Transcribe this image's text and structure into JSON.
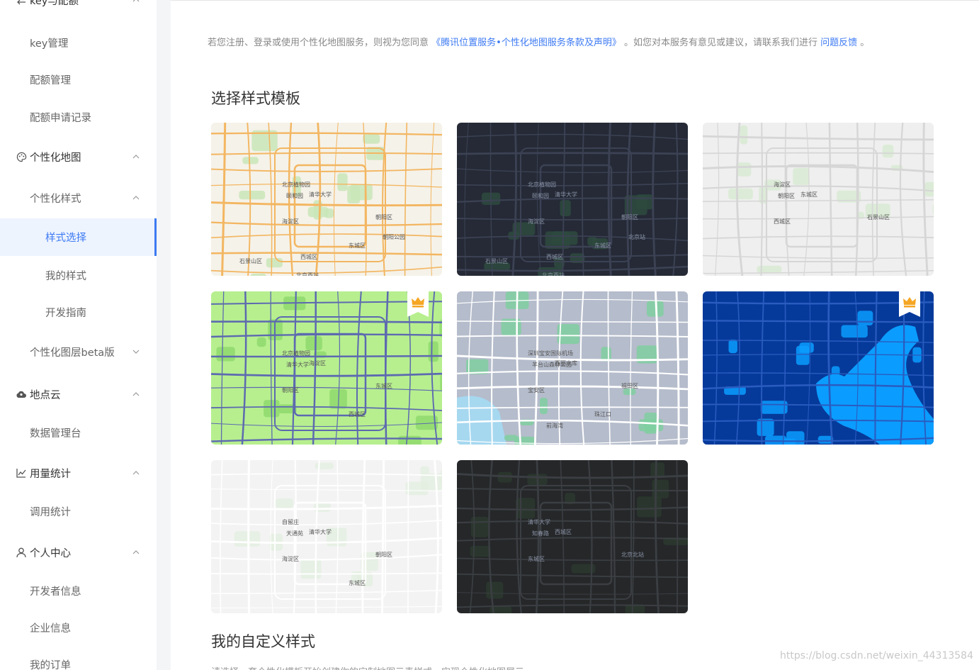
{
  "sidebar": {
    "items": [
      {
        "label": "key与配额",
        "level": "group",
        "icon": "swap-icon",
        "expanded": true
      },
      {
        "label": "key管理",
        "level": "sub"
      },
      {
        "label": "配额管理",
        "level": "sub"
      },
      {
        "label": "配额申请记录",
        "level": "sub"
      },
      {
        "label": "个性化地图",
        "level": "group",
        "icon": "palette-icon",
        "expanded": true
      },
      {
        "label": "个性化样式",
        "level": "sub",
        "expanded": true
      },
      {
        "label": "样式选择",
        "level": "sub2",
        "active": true
      },
      {
        "label": "我的样式",
        "level": "sub2"
      },
      {
        "label": "开发指南",
        "level": "sub2"
      },
      {
        "label": "个性化图层beta版",
        "level": "sub",
        "expanded": false
      },
      {
        "label": "地点云",
        "level": "group",
        "icon": "cloud-icon",
        "expanded": true
      },
      {
        "label": "数据管理台",
        "level": "sub"
      },
      {
        "label": "用量统计",
        "level": "group",
        "icon": "line-chart-icon",
        "expanded": true
      },
      {
        "label": "调用统计",
        "level": "sub"
      },
      {
        "label": "个人中心",
        "level": "group",
        "icon": "user-icon",
        "expanded": true
      },
      {
        "label": "开发者信息",
        "level": "sub"
      },
      {
        "label": "企业信息",
        "level": "sub"
      },
      {
        "label": "我的订单",
        "level": "sub"
      }
    ]
  },
  "notice": {
    "prefix": "若您注册、登录或使用个性化地图服务，则视为您同意",
    "terms_link": "《腾讯位置服务•个性化地图服务条款及声明》",
    "middle": "。如您对本服务有意见或建议，请联系我们进行",
    "feedback_link": "问题反馈",
    "suffix": "。"
  },
  "templates": {
    "title": "选择样式模板",
    "cards": [
      {
        "name": "classic-light",
        "bg": "#f5f2e9",
        "road": "#f3b661",
        "green": "#c9e6b8",
        "premium": false
      },
      {
        "name": "dark",
        "bg": "#252a36",
        "road": "#3c4254",
        "green": "#2e4a3e",
        "premium": false
      },
      {
        "name": "gray",
        "bg": "#efefef",
        "road": "#d6d6d6",
        "green": "#d8ead2",
        "premium": false
      },
      {
        "name": "green",
        "bg": "#b7ef8f",
        "road": "#5d6ab0",
        "green": "#8fd96d",
        "premium": true
      },
      {
        "name": "slate",
        "bg": "#b5bccb",
        "road": "#ffffff",
        "green": "#7fcfa0",
        "premium": false
      },
      {
        "name": "deep-blue",
        "bg": "#063a9a",
        "road": "#2a5cc0",
        "green": "#0a9dff",
        "premium": true
      },
      {
        "name": "white",
        "bg": "#f3f3f3",
        "road": "#ffffff",
        "green": "#e3efe0",
        "premium": false
      },
      {
        "name": "charcoal",
        "bg": "#252729",
        "road": "#3b3e42",
        "green": "#2b3a2e",
        "premium": false
      }
    ],
    "map_labels": {
      "classic-light": [
        "北京植物园",
        "颐和园",
        "清华大学",
        "海淀区",
        "朝阳区",
        "东城区",
        "西城区",
        "石景山区",
        "北京西站",
        "朝阳公园"
      ],
      "dark": [
        "北京植物园",
        "颐和园",
        "清华大学",
        "海淀区",
        "朝阳区",
        "东城区",
        "西城区",
        "石景山区",
        "北京西站",
        "北京站"
      ],
      "gray": [
        "海淀区",
        "朝阳区",
        "东城区",
        "西城区",
        "石景山区"
      ],
      "green": [
        "北京植物园",
        "清华大学",
        "海淀区",
        "朝阳区",
        "东城区",
        "西城区"
      ],
      "slate": [
        "深圳宝安国际机场",
        "羊台山森林公园",
        "西丽水库",
        "宝安区",
        "福田区",
        "珠江口",
        "前海湾"
      ],
      "deep-blue": [],
      "white": [
        "自留庄",
        "天通苑",
        "清华大学",
        "海淀区",
        "朝阳区",
        "东城区"
      ],
      "charcoal": [
        "清华大学",
        "知春路",
        "西城区",
        "东城区",
        "北京北站"
      ]
    }
  },
  "custom": {
    "title": "我的自定义样式",
    "note": "请选择一套个性化模板开始创建你的定制地图元素样式，实现个性化地图展示。"
  },
  "watermark": "https://blog.csdn.net/weixin_44313584"
}
